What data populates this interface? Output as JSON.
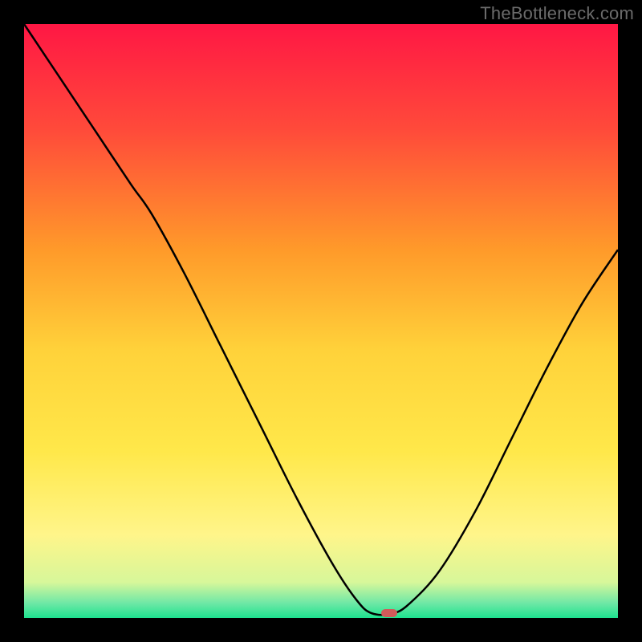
{
  "attribution": "TheBottleneck.com",
  "colors": {
    "frame": "#000000",
    "attribution_text": "#6b6b6b",
    "curve_stroke": "#000000",
    "marker_fill": "#d15a5a"
  },
  "gradient": {
    "type": "linear-vertical",
    "stops": [
      {
        "offset": 0.0,
        "color": "#ff1744"
      },
      {
        "offset": 0.18,
        "color": "#ff4b3a"
      },
      {
        "offset": 0.38,
        "color": "#ff9a2a"
      },
      {
        "offset": 0.55,
        "color": "#ffd23a"
      },
      {
        "offset": 0.72,
        "color": "#ffe84a"
      },
      {
        "offset": 0.86,
        "color": "#fff58a"
      },
      {
        "offset": 0.94,
        "color": "#d7f79a"
      },
      {
        "offset": 0.975,
        "color": "#6fe8a6"
      },
      {
        "offset": 1.0,
        "color": "#1ee28f"
      }
    ]
  },
  "chart_data": {
    "type": "line",
    "title": "",
    "xlabel": "",
    "ylabel": "",
    "x_range": [
      0,
      1
    ],
    "y_range": [
      0,
      1
    ],
    "note": "x and y are normalized 0–1 inside the plot area; y measured from top (0) to bottom (1). Curve dips to ~1.0 near x≈0.62 then rises.",
    "series": [
      {
        "name": "bottleneck-curve",
        "points": [
          {
            "x": 0.0,
            "y": 0.0
          },
          {
            "x": 0.06,
            "y": 0.09
          },
          {
            "x": 0.12,
            "y": 0.18
          },
          {
            "x": 0.18,
            "y": 0.27
          },
          {
            "x": 0.215,
            "y": 0.32
          },
          {
            "x": 0.27,
            "y": 0.42
          },
          {
            "x": 0.33,
            "y": 0.54
          },
          {
            "x": 0.4,
            "y": 0.68
          },
          {
            "x": 0.46,
            "y": 0.8
          },
          {
            "x": 0.52,
            "y": 0.91
          },
          {
            "x": 0.56,
            "y": 0.97
          },
          {
            "x": 0.585,
            "y": 0.992
          },
          {
            "x": 0.62,
            "y": 0.993
          },
          {
            "x": 0.65,
            "y": 0.975
          },
          {
            "x": 0.7,
            "y": 0.92
          },
          {
            "x": 0.76,
            "y": 0.82
          },
          {
            "x": 0.82,
            "y": 0.7
          },
          {
            "x": 0.88,
            "y": 0.58
          },
          {
            "x": 0.94,
            "y": 0.47
          },
          {
            "x": 1.0,
            "y": 0.38
          }
        ]
      }
    ],
    "marker": {
      "x": 0.615,
      "y": 0.992,
      "name": "optimum-marker"
    }
  }
}
